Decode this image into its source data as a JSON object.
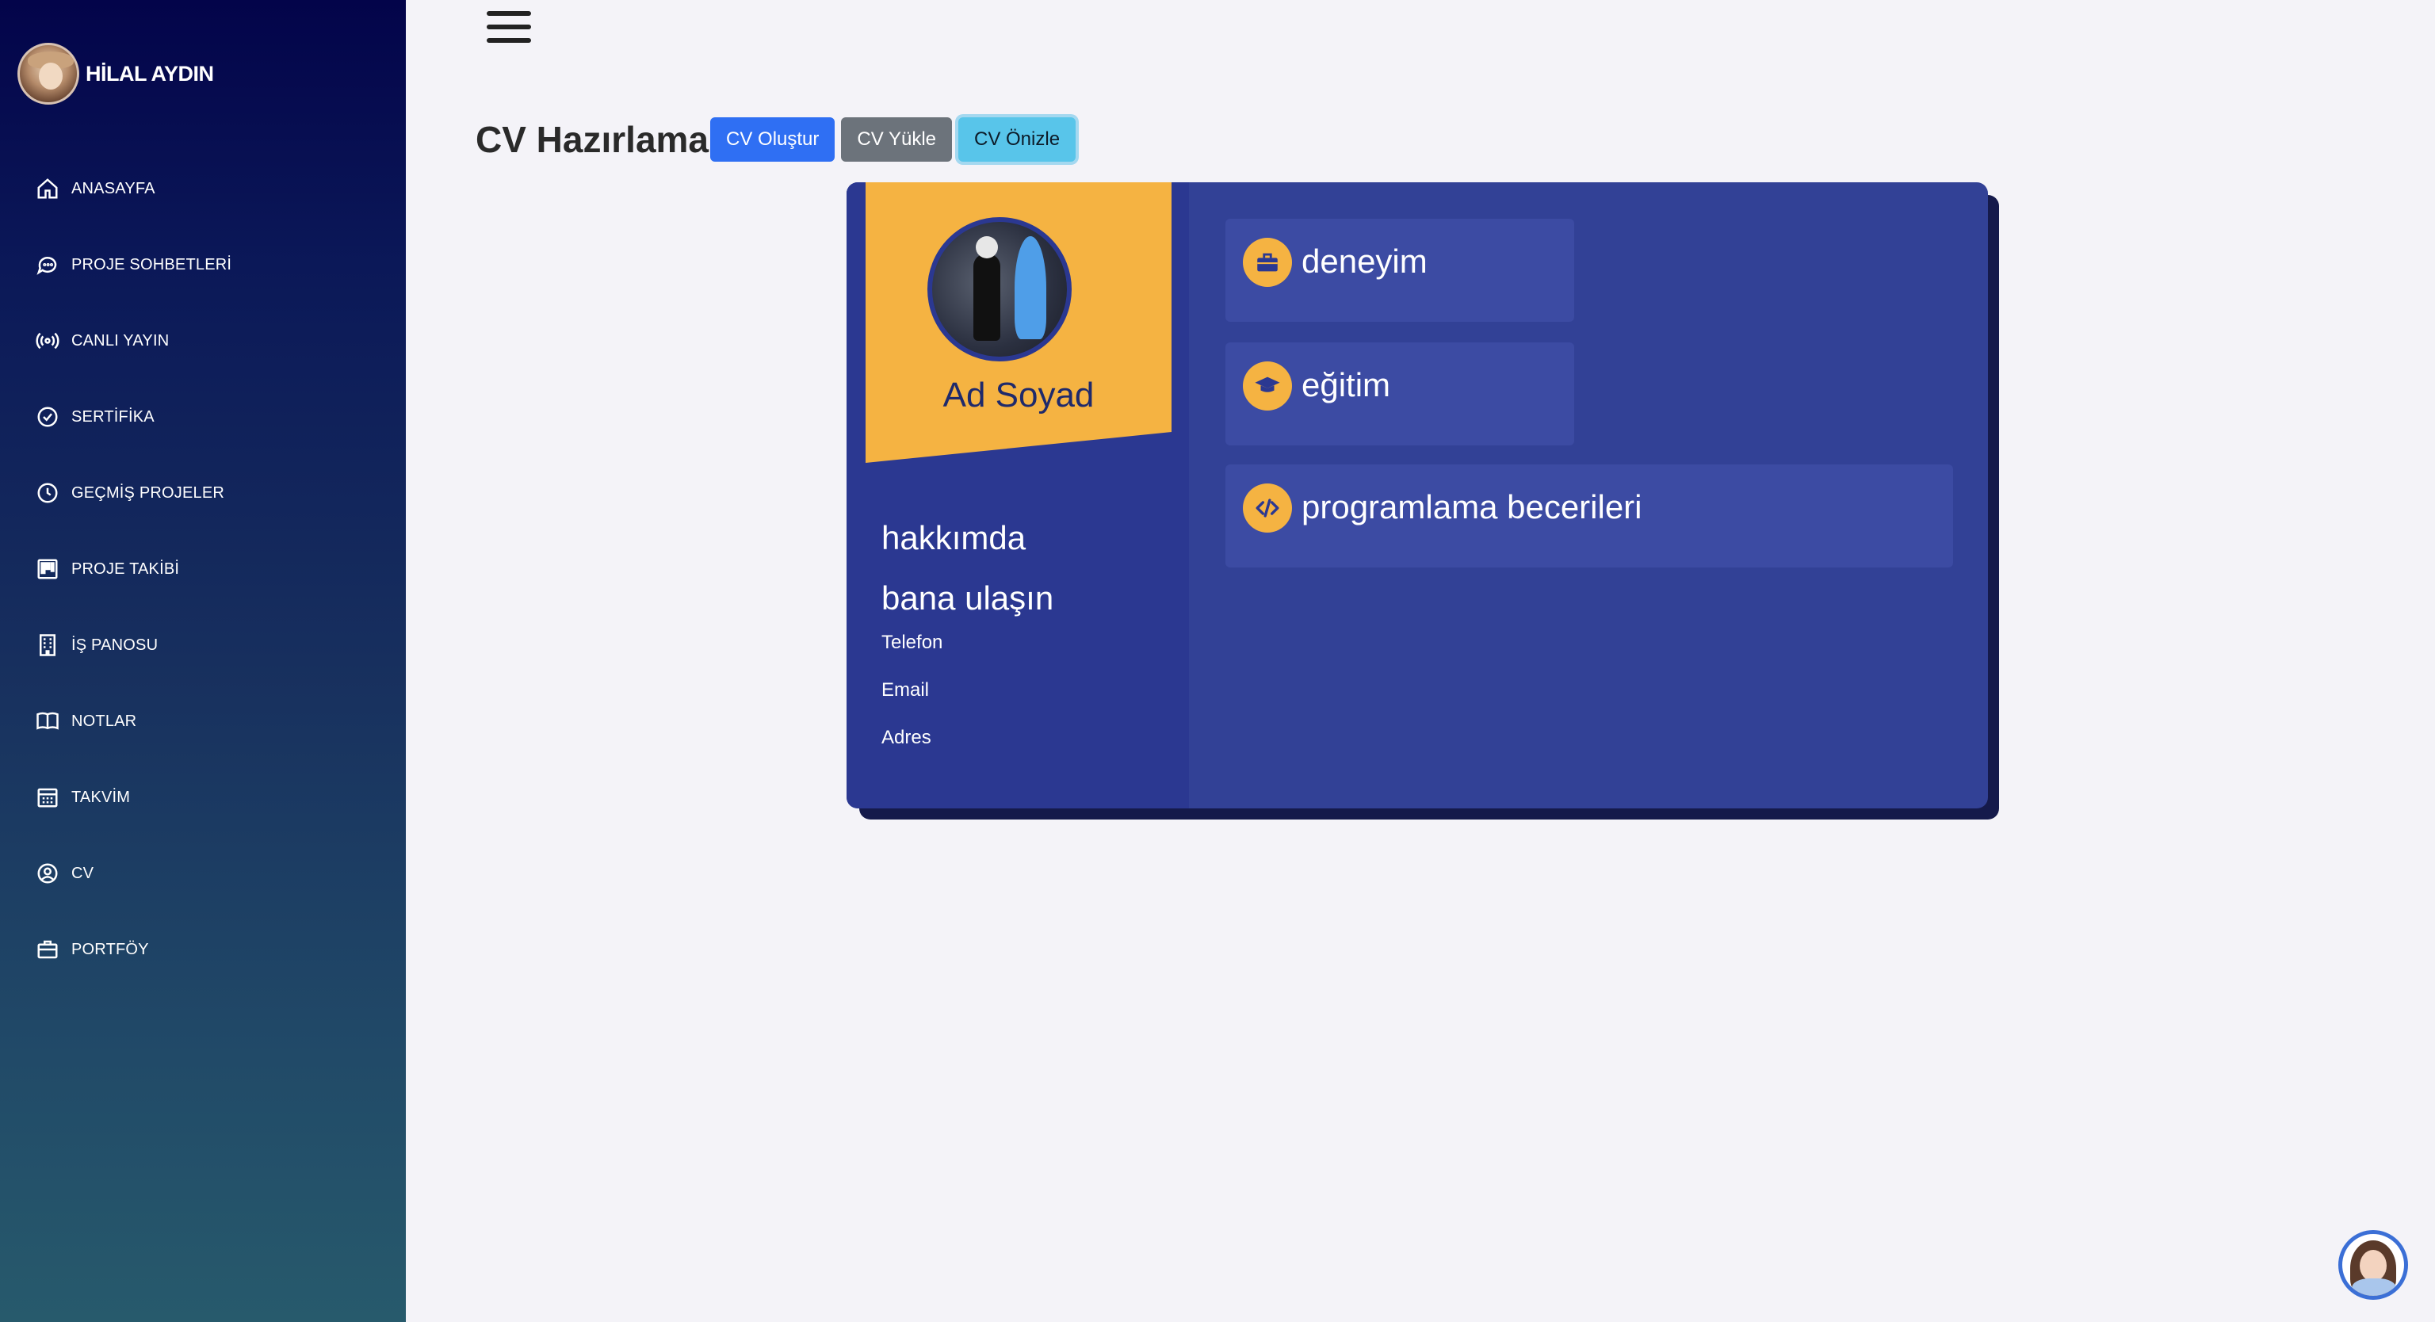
{
  "profile": {
    "name": "HİLAL AYDIN"
  },
  "sidebar": {
    "items": [
      {
        "label": "ANASAYFA",
        "icon": "home-icon"
      },
      {
        "label": "PROJE SOHBETLERİ",
        "icon": "chat-icon"
      },
      {
        "label": "CANLI YAYIN",
        "icon": "broadcast-icon"
      },
      {
        "label": "SERTİFİKA",
        "icon": "badge-check-icon"
      },
      {
        "label": "GEÇMİŞ PROJELER",
        "icon": "clock-icon"
      },
      {
        "label": "PROJE TAKİBİ",
        "icon": "kanban-icon"
      },
      {
        "label": "İŞ PANOSU",
        "icon": "building-icon"
      },
      {
        "label": "NOTLAR",
        "icon": "book-icon"
      },
      {
        "label": "TAKVİM",
        "icon": "calendar-icon"
      },
      {
        "label": "CV",
        "icon": "user-circle-icon"
      },
      {
        "label": "PORTFÖY",
        "icon": "briefcase-icon"
      }
    ]
  },
  "header": {
    "title": "CV Hazırlama",
    "buttons": {
      "create": "CV Oluştur",
      "upload": "CV Yükle",
      "preview": "CV Önizle"
    }
  },
  "cv": {
    "name": "Ad Soyad",
    "about_heading": "hakkımda",
    "contact_heading": "bana ulaşın",
    "contact": {
      "phone": "Telefon",
      "email": "Email",
      "address": "Adres"
    },
    "sections": {
      "experience": "deneyim",
      "education": "eğitim",
      "skills": "programlama becerileri"
    }
  },
  "colors": {
    "accent_yellow": "#f5b342",
    "card_blue": "#324196",
    "primary_button": "#2f6ff3",
    "secondary_button": "#6c737b",
    "info_button": "#58c5ea"
  }
}
